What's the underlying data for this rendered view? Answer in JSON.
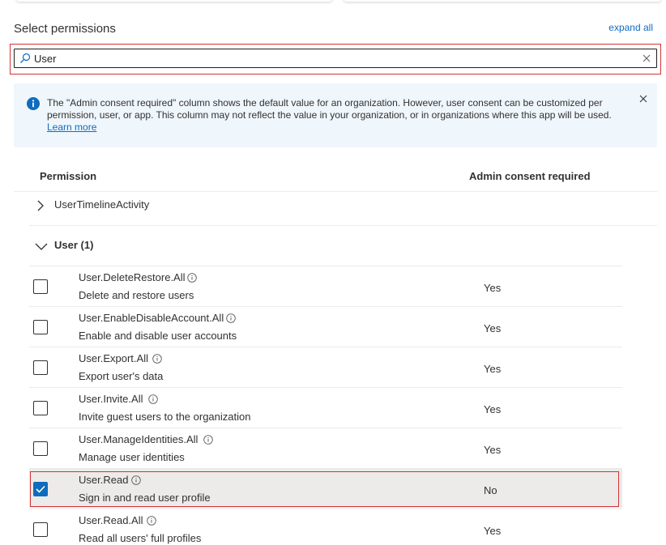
{
  "section_title": "Select permissions",
  "expand_all": "expand all",
  "search": {
    "value": "User"
  },
  "info_bar": {
    "text": "The \"Admin consent required\" column shows the default value for an organization. However, user consent can be customized per permission, user, or app. This column may not reflect the value in your organization, or in organizations where this app will be used.",
    "link": "Learn more"
  },
  "columns": {
    "permission": "Permission",
    "admin_consent": "Admin consent required"
  },
  "groups": [
    {
      "label": "UserTimelineActivity",
      "expanded": false
    },
    {
      "label": "User (1)",
      "expanded": true
    }
  ],
  "permissions": [
    {
      "name": "User.DeleteRestore.All",
      "desc": "Delete and restore users",
      "consent": "Yes",
      "checked": false
    },
    {
      "name": "User.EnableDisableAccount.All",
      "desc": "Enable and disable user accounts",
      "consent": "Yes",
      "checked": false
    },
    {
      "name": "User.Export.All",
      "desc": "Export user's data",
      "consent": "Yes",
      "checked": false
    },
    {
      "name": "User.Invite.All",
      "desc": "Invite guest users to the organization",
      "consent": "Yes",
      "checked": false
    },
    {
      "name": "User.ManageIdentities.All",
      "desc": "Manage user identities",
      "consent": "Yes",
      "checked": false
    },
    {
      "name": "User.Read",
      "desc": "Sign in and read user profile",
      "consent": "No",
      "checked": true
    },
    {
      "name": "User.Read.All",
      "desc": "Read all users' full profiles",
      "consent": "Yes",
      "checked": false
    }
  ],
  "colors": {
    "accent": "#0f6cbd",
    "highlight_border": "#d13438",
    "info_bg": "#eff6fc"
  }
}
